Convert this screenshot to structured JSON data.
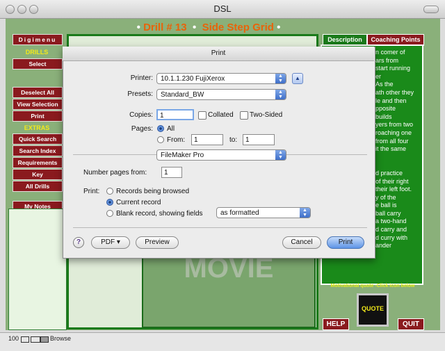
{
  "window": {
    "title": "DSL"
  },
  "layout": {
    "drill_label": "Drill # 13",
    "drill_name": "Side Step Grid",
    "left_buttons_top": [
      "Digimenu"
    ],
    "drills_heading": "DRILLS",
    "drills_select": "Select",
    "drill_buttons": [
      "Deselect All",
      "View Selection",
      "Print"
    ],
    "extras_heading": "EXTRAS",
    "extras_buttons": [
      "Quick Search",
      "Search Index",
      "Requirements",
      "Key",
      "All Drills"
    ],
    "my_notes": "My Notes",
    "notes_count": "100",
    "movie_label": "MOVIE",
    "tabs": [
      "Description",
      "Coaching Points"
    ],
    "description_lines": [
      "n comer of",
      "ars from",
      "start running",
      "er",
      "As the",
      "ath other they",
      "le and then",
      "pposite",
      "builds",
      "yers from two",
      "roaching one",
      "from all four",
      "it the same",
      "",
      "",
      "d practice",
      "of their right",
      "their left foot.",
      "y of the",
      "e ball is",
      "ball carry",
      "a two-hand",
      "d carry and",
      "d curry with",
      "ander"
    ],
    "motivational": "Motivational quote -Click icon below",
    "quote_label": "QUOTE",
    "help_button": "HELP",
    "quit_button": "QUIT"
  },
  "status_bar": {
    "zoom": "100",
    "mode": "Browse"
  },
  "dialog": {
    "title": "Print",
    "printer_label": "Printer:",
    "printer_value": "10.1.1.230 FujiXerox",
    "presets_label": "Presets:",
    "presets_value": "Standard_BW",
    "copies_label": "Copies:",
    "copies_value": "1",
    "collated_label": "Collated",
    "two_sided_label": "Two-Sided",
    "pages_label": "Pages:",
    "pages_all": "All",
    "pages_from": "From:",
    "pages_from_value": "1",
    "pages_to": "to:",
    "pages_to_value": "1",
    "section_value": "FileMaker Pro",
    "number_pages_label": "Number pages from:",
    "number_pages_value": "1",
    "print_label": "Print:",
    "print_options": [
      "Records being browsed",
      "Current record",
      "Blank record, showing fields"
    ],
    "selected_option": 1,
    "blank_format_value": "as formatted",
    "pdf_button": "PDF ▾",
    "preview_button": "Preview",
    "cancel_button": "Cancel",
    "print_button": "Print",
    "help_glyph": "?"
  }
}
